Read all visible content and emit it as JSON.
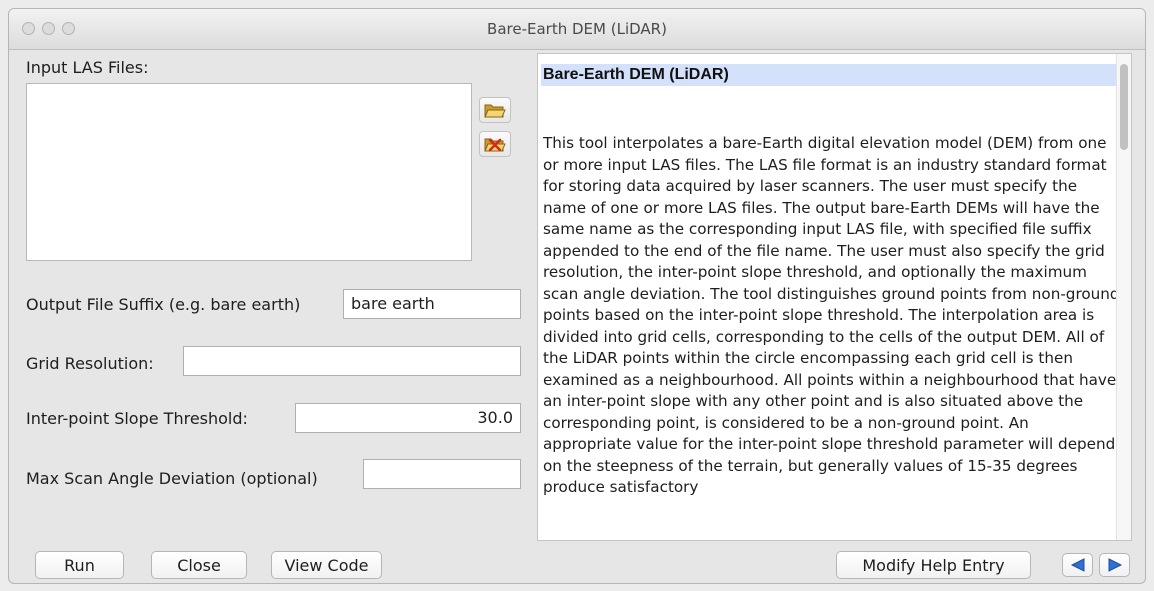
{
  "window": {
    "title": "Bare-Earth DEM (LiDAR)"
  },
  "left": {
    "input_files_label": "Input LAS Files:",
    "input_files": [],
    "add_icon": "folder-open-icon",
    "remove_icon": "folder-remove-icon",
    "suffix_label": "Output File Suffix (e.g. bare earth)",
    "suffix_value": "bare earth",
    "grid_label": "Grid Resolution:",
    "grid_value": "",
    "slope_label": "Inter-point Slope Threshold:",
    "slope_value": "30.0",
    "scan_label": "Max Scan Angle Deviation (optional)",
    "scan_value": ""
  },
  "help": {
    "title": "Bare-Earth DEM (LiDAR)",
    "body": "This tool interpolates a bare-Earth digital elevation model (DEM) from one or more input LAS files. The LAS file format is an industry standard format for storing data acquired by laser scanners. The user must specify the name of one or more LAS files. The output bare-Earth DEMs will have the same name as the corresponding input LAS file, with specified file suffix appended to the end of the file name. The user must also specify the grid resolution, the inter-point slope threshold, and optionally the maximum scan angle deviation. The tool distinguishes ground points from non-ground points based on the inter-point slope threshold. The interpolation area is divided into grid cells, corresponding to the cells of the output DEM. All of the LiDAR points within the circle encompassing each grid cell is then examined as a neighbourhood. All points within a neighbourhood that have an inter-point slope with any other point and is also situated above the corresponding point, is considered to be a non-ground point. An appropriate value for the inter-point slope threshold parameter will depend on the steepness of the terrain, but generally values of 15-35 degrees produce satisfactory"
  },
  "buttons": {
    "run": "Run",
    "close": "Close",
    "view_code": "View Code",
    "modify_help": "Modify Help Entry",
    "prev_icon": "arrow-left-icon",
    "next_icon": "arrow-right-icon"
  },
  "colors": {
    "help_title_bg": "#d3e1fb",
    "nav_arrow": "#2f6fd6",
    "remove_x": "#d32a1e",
    "folder": "#e8c45a"
  }
}
